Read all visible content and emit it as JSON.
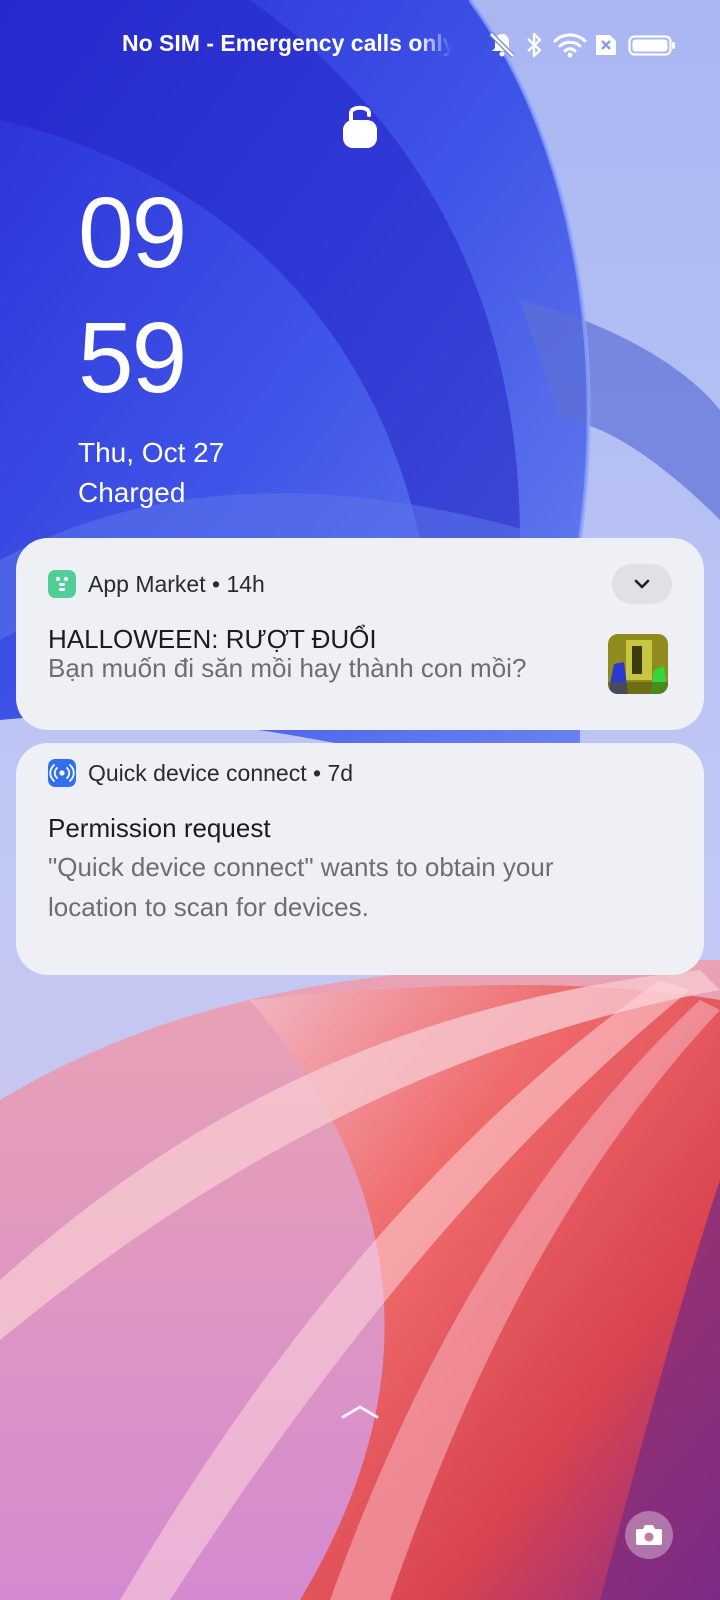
{
  "status_bar": {
    "carrier_text": "No SIM - Emergency calls only",
    "icons": [
      "mute-notifications-icon",
      "bluetooth-icon",
      "wifi-icon",
      "no-sim-icon",
      "battery-icon"
    ]
  },
  "lock": {
    "icon": "lock-icon"
  },
  "clock": {
    "hour": "09",
    "minute": "59",
    "date": "Thu, Oct 27",
    "status": "Charged"
  },
  "notifications": [
    {
      "app": "App Market",
      "age": "14h",
      "title": "HALLOWEEN: RƯỢT ĐUỔI",
      "body": "Bạn muốn đi săn mồi hay thành con mồi?",
      "icon": "app-market-icon",
      "accent": "#4fcf95"
    },
    {
      "app": "Quick device connect",
      "age": "7d",
      "title": "Permission request",
      "body": "\"Quick device connect\" wants to obtain your location to scan for devices.",
      "icon": "quick-device-connect-icon",
      "accent": "#2f6ff0"
    }
  ],
  "bottom": {
    "swipe_icon": "chevron-up-icon",
    "camera_icon": "camera-icon"
  }
}
